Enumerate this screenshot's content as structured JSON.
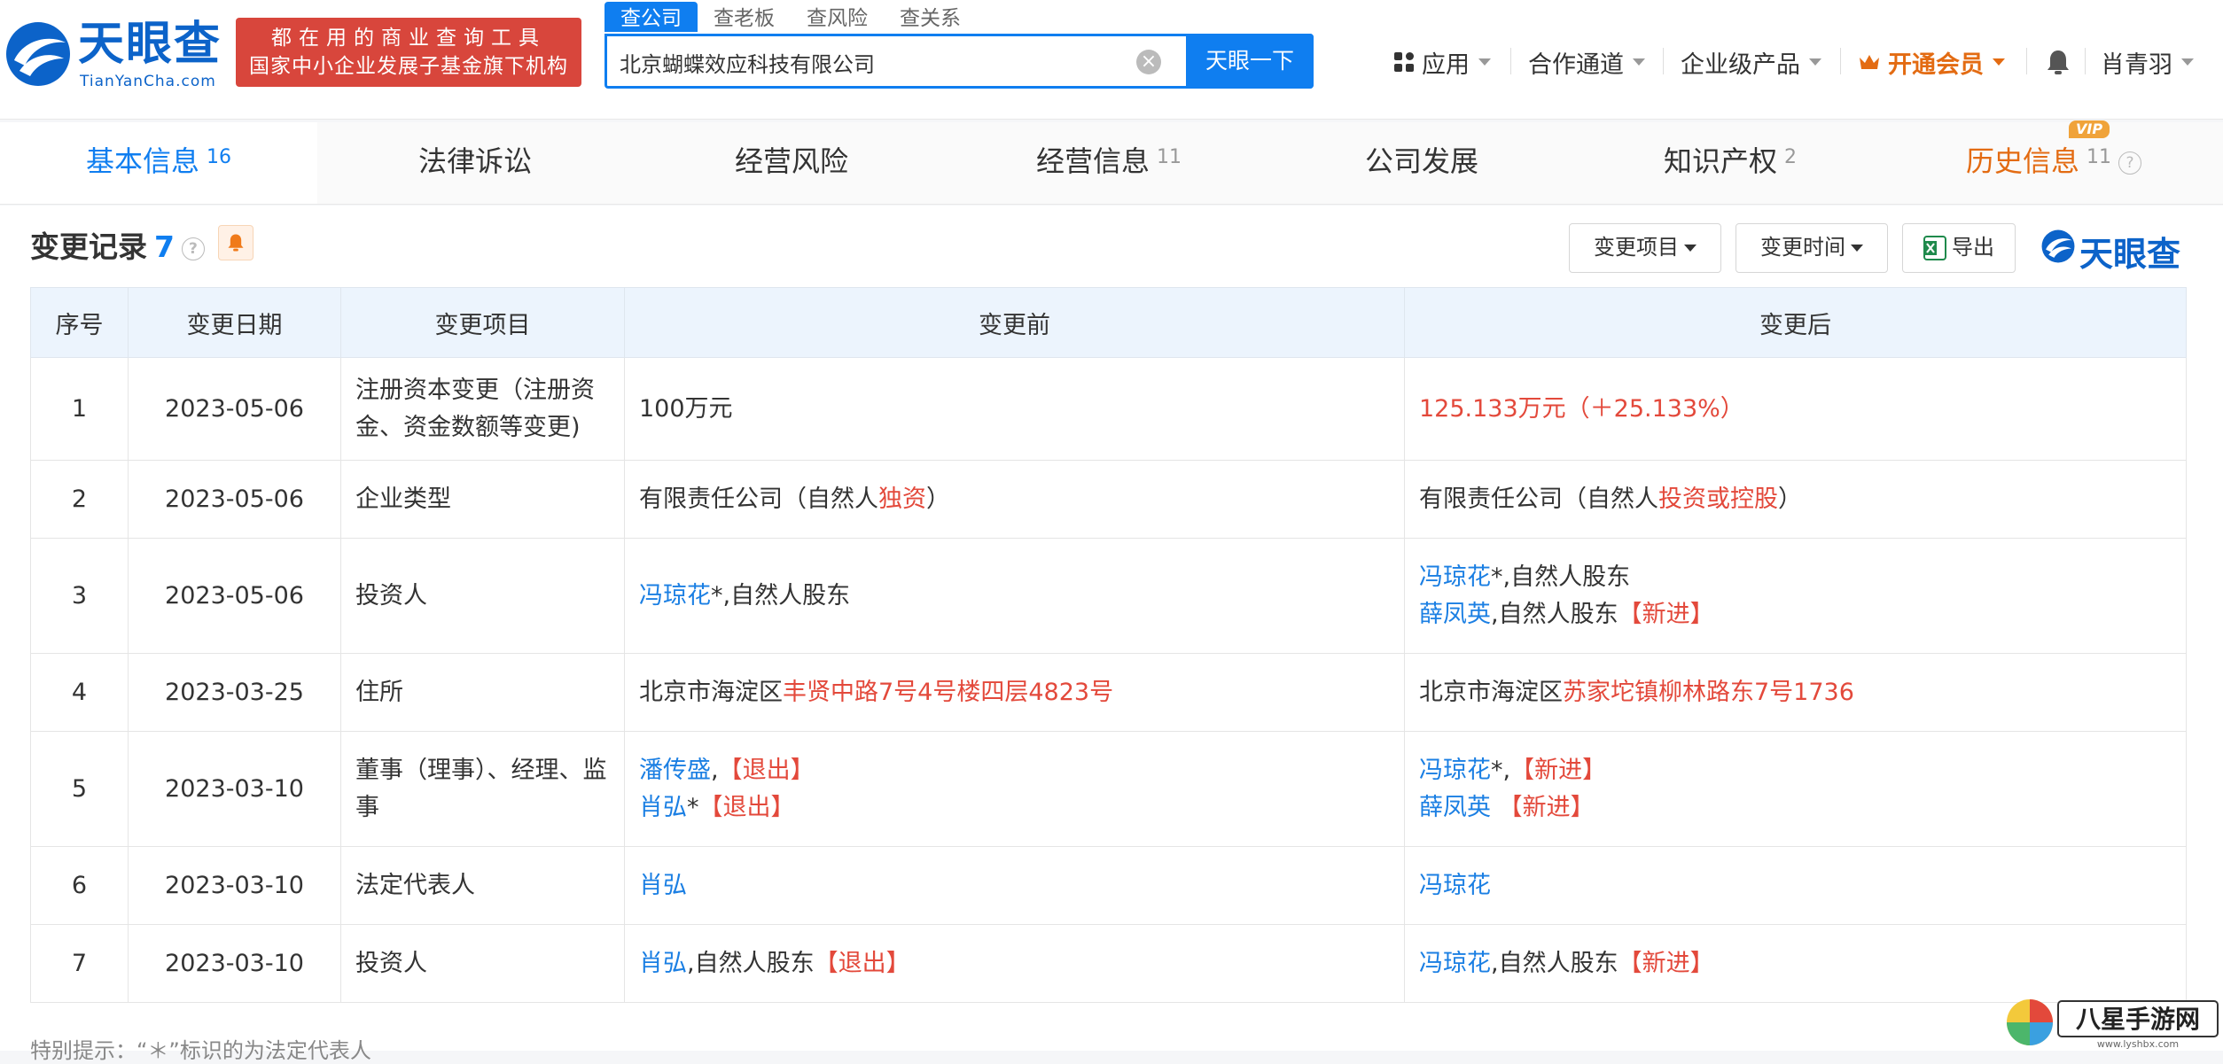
{
  "header": {
    "logo_text": "天眼查",
    "logo_sub": "TianYanCha.com",
    "slogan_line1": "都在用的商业查询工具",
    "slogan_line2": "国家中小企业发展子基金旗下机构",
    "search_tabs": [
      "查公司",
      "查老板",
      "查风险",
      "查关系"
    ],
    "search_value": "北京蝴蝶效应科技有限公司",
    "search_button": "天眼一下",
    "nav": {
      "apps": "应用",
      "cooperation": "合作通道",
      "enterprise": "企业级产品",
      "vip": "开通会员",
      "user": "肖青羽"
    }
  },
  "tabs": [
    {
      "label": "基本信息",
      "count": "16"
    },
    {
      "label": "法律诉讼",
      "count": ""
    },
    {
      "label": "经营风险",
      "count": ""
    },
    {
      "label": "经营信息",
      "count": "11"
    },
    {
      "label": "公司发展",
      "count": ""
    },
    {
      "label": "知识产权",
      "count": "2"
    },
    {
      "label": "历史信息",
      "count": "11"
    }
  ],
  "vip_badge": "VIP",
  "section": {
    "title": "变更记录",
    "count": "7",
    "filter_item": "变更项目",
    "filter_time": "变更时间",
    "export": "导出",
    "brand": "天眼查"
  },
  "table": {
    "headers": [
      "序号",
      "变更日期",
      "变更项目",
      "变更前",
      "变更后"
    ],
    "rows": [
      {
        "no": "1",
        "date": "2023-05-06",
        "item": "注册资本变更（注册资金、资金数额等变更)",
        "before": [
          [
            {
              "t": "100万元",
              "c": ""
            }
          ]
        ],
        "after": [
          [
            {
              "t": "125.133万元（＋25.133%）",
              "c": "red"
            }
          ]
        ]
      },
      {
        "no": "2",
        "date": "2023-05-06",
        "item": "企业类型",
        "before": [
          [
            {
              "t": "有限责任公司（自然人",
              "c": ""
            },
            {
              "t": "独资",
              "c": "red"
            },
            {
              "t": "）",
              "c": ""
            }
          ]
        ],
        "after": [
          [
            {
              "t": "有限责任公司（自然人",
              "c": ""
            },
            {
              "t": "投资或控股",
              "c": "red"
            },
            {
              "t": "）",
              "c": ""
            }
          ]
        ]
      },
      {
        "no": "3",
        "date": "2023-05-06",
        "item": "投资人",
        "before": [
          [
            {
              "t": "冯琼花",
              "c": "blue"
            },
            {
              "t": "*,自然人股东",
              "c": ""
            }
          ]
        ],
        "after": [
          [
            {
              "t": "冯琼花",
              "c": "blue"
            },
            {
              "t": "*,自然人股东",
              "c": ""
            }
          ],
          [
            {
              "t": "薛凤英",
              "c": "blue"
            },
            {
              "t": ",自然人股东",
              "c": ""
            },
            {
              "t": "【新进】",
              "c": "red"
            }
          ]
        ]
      },
      {
        "no": "4",
        "date": "2023-03-25",
        "item": "住所",
        "before": [
          [
            {
              "t": "北京市海淀区",
              "c": ""
            },
            {
              "t": "丰贤中路7号4号楼四层4823号",
              "c": "red"
            }
          ]
        ],
        "after": [
          [
            {
              "t": "北京市海淀区",
              "c": ""
            },
            {
              "t": "苏家坨镇柳林路东7号1736",
              "c": "red"
            }
          ]
        ]
      },
      {
        "no": "5",
        "date": "2023-03-10",
        "item": "董事（理事）、经理、监事",
        "before": [
          [
            {
              "t": "潘传盛",
              "c": "blue"
            },
            {
              "t": ",",
              "c": ""
            },
            {
              "t": "【退出】",
              "c": "red"
            }
          ],
          [
            {
              "t": "肖弘",
              "c": "blue"
            },
            {
              "t": "*",
              "c": ""
            },
            {
              "t": "【退出】",
              "c": "red"
            }
          ]
        ],
        "after": [
          [
            {
              "t": "冯琼花",
              "c": "blue"
            },
            {
              "t": "*,",
              "c": ""
            },
            {
              "t": "【新进】",
              "c": "red"
            }
          ],
          [
            {
              "t": "薛凤英",
              "c": "blue"
            },
            {
              "t": " ",
              "c": ""
            },
            {
              "t": "【新进】",
              "c": "red"
            }
          ]
        ]
      },
      {
        "no": "6",
        "date": "2023-03-10",
        "item": "法定代表人",
        "before": [
          [
            {
              "t": "肖弘",
              "c": "blue"
            }
          ]
        ],
        "after": [
          [
            {
              "t": "冯琼花",
              "c": "blue"
            }
          ]
        ]
      },
      {
        "no": "7",
        "date": "2023-03-10",
        "item": "投资人",
        "before": [
          [
            {
              "t": "肖弘",
              "c": "blue"
            },
            {
              "t": ",自然人股东",
              "c": ""
            },
            {
              "t": "【退出】",
              "c": "red"
            }
          ]
        ],
        "after": [
          [
            {
              "t": "冯琼花",
              "c": "blue"
            },
            {
              "t": ",自然人股东",
              "c": ""
            },
            {
              "t": "【新进】",
              "c": "red"
            }
          ]
        ]
      }
    ]
  },
  "footnote": "特别提示：“＊”标识的为法定代表人",
  "watermark": {
    "text": "八星手游网",
    "url": "www.lyshbx.com"
  },
  "colors": {
    "accent": "#0f7ef0",
    "highlight_red": "#e3493b",
    "vip_orange": "#e36b12",
    "slogan_bg": "#d8463c"
  }
}
